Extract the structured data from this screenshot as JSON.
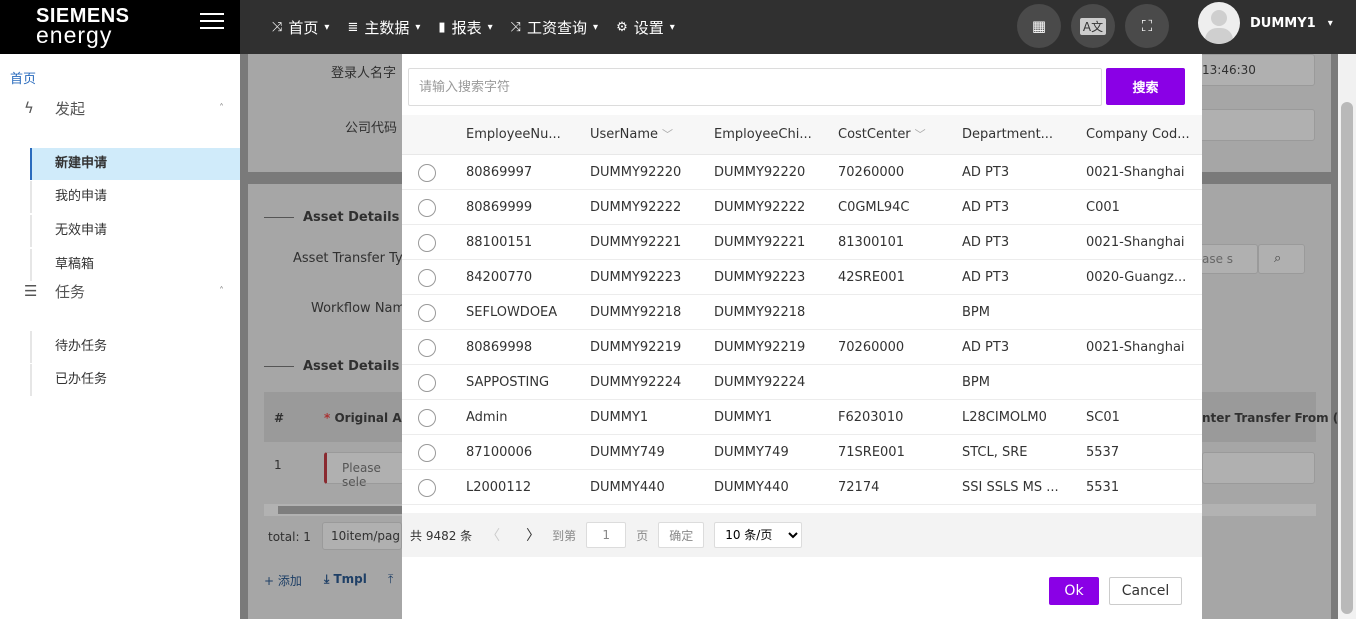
{
  "brand": {
    "line1": "SIEMENS",
    "line2": "energy"
  },
  "nav": [
    {
      "icon": "shuffle-icon",
      "glyph": "⤨",
      "label": "首页"
    },
    {
      "icon": "database-icon",
      "glyph": "≣",
      "label": "主数据"
    },
    {
      "icon": "bar-chart-icon",
      "glyph": "▮",
      "label": "报表"
    },
    {
      "icon": "shuffle-icon",
      "glyph": "⤨",
      "label": "工资查询"
    },
    {
      "icon": "gear-icon",
      "glyph": "⚙",
      "label": "设置"
    }
  ],
  "user": {
    "name": "DUMMY1"
  },
  "sidebar": {
    "home": "首页",
    "groups": [
      {
        "label": "发起",
        "items": [
          "新建申请",
          "我的申请",
          "无效申请",
          "草稿箱"
        ]
      },
      {
        "label": "任务",
        "items": [
          "待办任务",
          "已办任务"
        ]
      }
    ]
  },
  "background": {
    "login_name_label": "登录人名字",
    "company_code_label": "公司代码",
    "time_value": "13:46:30",
    "asset_details_1": "Asset Details",
    "asset_transfer_type": "Asset Transfer Typ",
    "workflow_name": "Workflow Nam",
    "asset_details_2": "Asset Details",
    "col_hash": "#",
    "col_original": "Original Ass",
    "col_transfer_from": "nter Transfer From (C",
    "row_num": "1",
    "select_placeholder": "Please sele",
    "search_placeholder": "ase s",
    "total": "total: 1",
    "page_size": "10item/pag",
    "add": "添加",
    "tmpl": "Tmpl"
  },
  "modal": {
    "search_placeholder": "请输入搜索字符",
    "search_button": "搜索",
    "columns": [
      "EmployeeNu...",
      "UserName",
      "EmployeeChi...",
      "CostCenter",
      "Department...",
      "Company Cod..."
    ],
    "rows": [
      [
        "80869997",
        "DUMMY92220",
        "DUMMY92220",
        "70260000",
        "AD PT3",
        "0021-Shanghai"
      ],
      [
        "80869999",
        "DUMMY92222",
        "DUMMY92222",
        "C0GML94C",
        "AD PT3",
        "C001"
      ],
      [
        "88100151",
        "DUMMY92221",
        "DUMMY92221",
        "81300101",
        "AD PT3",
        "0021-Shanghai"
      ],
      [
        "84200770",
        "DUMMY92223",
        "DUMMY92223",
        "42SRE001",
        "AD PT3",
        "0020-Guangz..."
      ],
      [
        "SEFLOWDOEA",
        "DUMMY92218",
        "DUMMY92218",
        "",
        "BPM",
        ""
      ],
      [
        "80869998",
        "DUMMY92219",
        "DUMMY92219",
        "70260000",
        "AD PT3",
        "0021-Shanghai"
      ],
      [
        "SAPPOSTING",
        "DUMMY92224",
        "DUMMY92224",
        "",
        "BPM",
        ""
      ],
      [
        "Admin",
        "DUMMY1",
        "DUMMY1",
        "F6203010",
        "L28CIMOLM0",
        "SC01"
      ],
      [
        "87100006",
        "DUMMY749",
        "DUMMY749",
        "71SRE001",
        "STCL, SRE",
        "5537"
      ],
      [
        "L2000112",
        "DUMMY440",
        "DUMMY440",
        "72174",
        "SSI SSLS MS ...",
        "5531"
      ]
    ],
    "pager": {
      "total": "共 9482 条",
      "goto": "到第",
      "page_value": "1",
      "page_unit": "页",
      "confirm": "确定",
      "page_size": "10 条/页"
    },
    "ok": "Ok",
    "cancel": "Cancel"
  }
}
